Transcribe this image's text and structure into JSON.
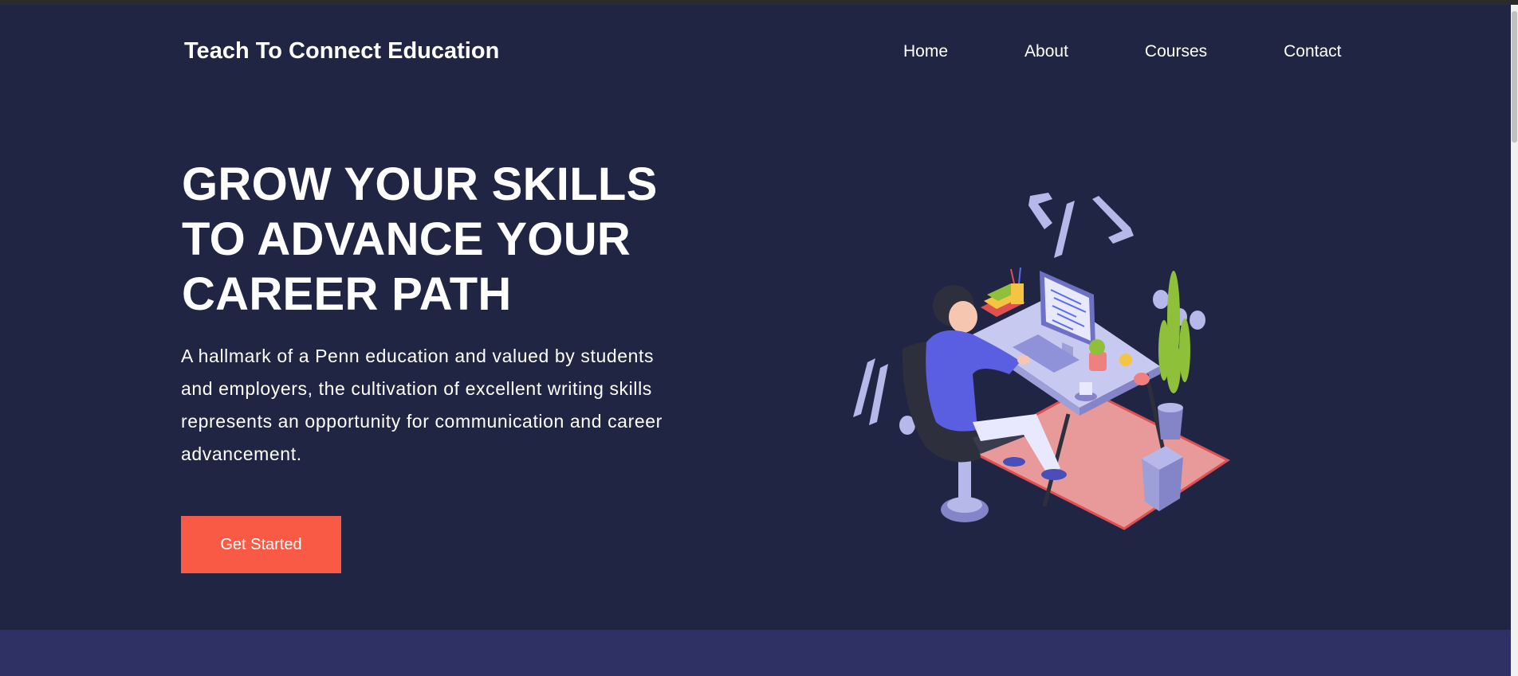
{
  "header": {
    "brand": "Teach To Connect Education",
    "nav": [
      {
        "label": "Home"
      },
      {
        "label": "About"
      },
      {
        "label": "Courses"
      },
      {
        "label": "Contact"
      }
    ]
  },
  "hero": {
    "headline_lines": [
      "GROW YOUR SKILLS",
      "TO ADVANCE YOUR",
      "CAREER PATH"
    ],
    "lead": "A hallmark of a Penn education and valued by students and employers, the cultivation of excellent writing skills represents an opportunity for communication and career advancement.",
    "cta_label": "Get Started",
    "illustration_icon": "person-coding-at-desk-illustration"
  },
  "colors": {
    "background": "#202543",
    "accent": "#f95a45",
    "lower_band": "#2f3064",
    "illustration_lavender": "#b6b8ea"
  }
}
